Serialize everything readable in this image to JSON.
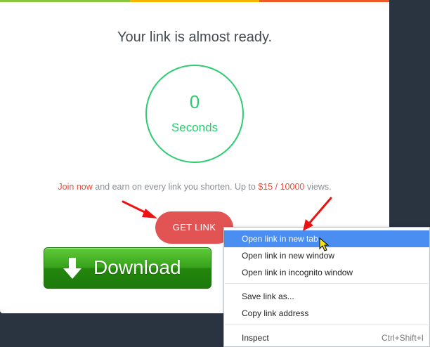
{
  "colors": {
    "bar": [
      "#8cc63f",
      "#f7b500",
      "#f05a28"
    ],
    "accent_green": "#2ecc71",
    "accent_red": "#e74c3c",
    "highlight": "#4a8ef2"
  },
  "card": {
    "title": "Your link is almost ready.",
    "timer": {
      "count": "0",
      "unit": "Seconds"
    },
    "promo": {
      "join": "Join now",
      "middle": " and earn on every link you shorten. Up to ",
      "rate": "$15 / 10000",
      "suffix": " views."
    },
    "get_link_label": "GET LINK"
  },
  "download_button": {
    "label": "Download",
    "icon": "download-arrow-icon"
  },
  "context_menu": {
    "items": [
      {
        "label": "Open link in new tab",
        "highlighted": true
      },
      {
        "label": "Open link in new window"
      },
      {
        "label": "Open link in incognito window"
      },
      {
        "label": "Save link as..."
      },
      {
        "label": "Copy link address"
      },
      {
        "label": "Inspect",
        "shortcut": "Ctrl+Shift+I"
      }
    ]
  },
  "annotations": {
    "arrows": [
      "red-arrow-icon",
      "red-arrow-icon"
    ],
    "cursor": "mouse-pointer-icon"
  }
}
